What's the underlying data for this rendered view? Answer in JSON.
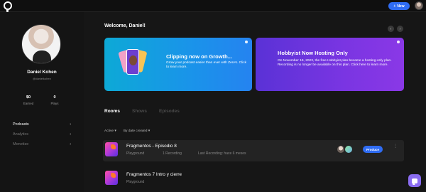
{
  "topbar": {
    "new_label": "New",
    "new_icon": "plus-icon"
  },
  "profile": {
    "name": "Daniel Kohen",
    "handle": "@danielkohen",
    "stats": [
      {
        "value": "$0",
        "label": "Earned"
      },
      {
        "value": "0",
        "label": "Plays"
      }
    ]
  },
  "sidebar": {
    "items": [
      {
        "label": "Podcasts",
        "chevron": "›"
      },
      {
        "label": "Analytics",
        "chevron": "›"
      },
      {
        "label": "Monetize",
        "chevron": "›"
      }
    ]
  },
  "main": {
    "welcome": "Welcome, Daniel!",
    "carousel": {
      "prev": "‹",
      "next": "›"
    },
    "cards": [
      {
        "title": "Clipping now on Growth...",
        "text": "Grow your podcast easier than ever with ZenAI. Click to learn more.",
        "color": "#1a93ea"
      },
      {
        "title": "Hobbyist Now Hosting Only",
        "text": "On November 16, 2023, the free Hobbyist plan became a hosting-only plan. Recording is no longer be available on this plan. Click here to learn more.",
        "color": "#7a35e2"
      }
    ],
    "tabs": [
      {
        "label": "Rooms",
        "active": true
      },
      {
        "label": "Shows",
        "active": false
      },
      {
        "label": "Episodes",
        "active": false
      }
    ],
    "filters": {
      "status": "Active ▾",
      "sort": "By date created ▾"
    },
    "episodes": [
      {
        "title": "Fragmentos - Episodio 8",
        "show": "Playground",
        "recordings": "1 Recording",
        "last": "Last Recording: hace 6 meses",
        "action": "Produce",
        "more": "⋮"
      },
      {
        "title": "Fragmentos 7 Intro y cierre",
        "show": "Playground"
      }
    ]
  },
  "accent": "#2f6cf3"
}
